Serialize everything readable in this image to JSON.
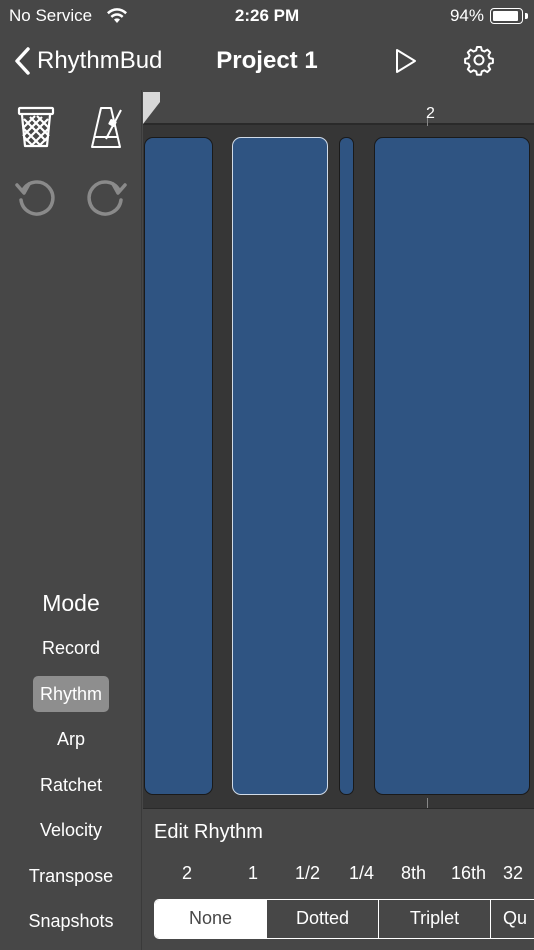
{
  "status": {
    "carrier": "No Service",
    "time": "2:26 PM",
    "battery_pct": "94%",
    "battery_level": 0.94
  },
  "nav": {
    "back_label": "RhythmBud",
    "title": "Project 1"
  },
  "sidebar": {
    "tools": [
      "trash-icon",
      "metronome-icon",
      "undo-icon",
      "redo-icon"
    ],
    "mode_heading": "Mode",
    "modes": [
      {
        "label": "Record",
        "selected": false
      },
      {
        "label": "Rhythm",
        "selected": true
      },
      {
        "label": "Arp",
        "selected": false
      },
      {
        "label": "Ratchet",
        "selected": false
      },
      {
        "label": "Velocity",
        "selected": false
      },
      {
        "label": "Transpose",
        "selected": false
      },
      {
        "label": "Snapshots",
        "selected": false
      }
    ]
  },
  "editor": {
    "bar_label": "2",
    "note_color": "#2f5482"
  },
  "panel": {
    "title": "Edit Rhythm",
    "durations": [
      "2",
      "1",
      "1/2",
      "1/4",
      "8th",
      "16th",
      "32"
    ],
    "modifiers": [
      {
        "label": "None",
        "selected": true
      },
      {
        "label": "Dotted",
        "selected": false
      },
      {
        "label": "Triplet",
        "selected": false
      },
      {
        "label": "Qu",
        "selected": false
      }
    ]
  }
}
